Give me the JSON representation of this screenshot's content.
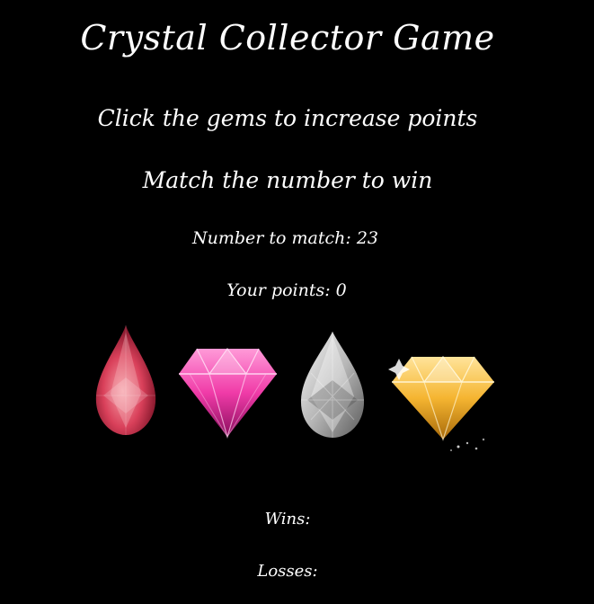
{
  "header": {
    "title": "Crystal Collector Game",
    "instruction_1": "Click the gems to increase points",
    "instruction_2": "Match the number to win"
  },
  "scoreboard": {
    "target_label": "Number to match: 23",
    "points_label": "Your points: 0",
    "wins_label": "Wins:",
    "losses_label": "Losses:"
  },
  "gems": [
    {
      "icon": "red-pear-gem-icon",
      "color": "#d9405a"
    },
    {
      "icon": "pink-round-gem-icon",
      "color": "#f03ba8"
    },
    {
      "icon": "white-pear-gem-icon",
      "color": "#d8d8d8"
    },
    {
      "icon": "yellow-round-gem-icon",
      "color": "#f5b531"
    }
  ],
  "colors": {
    "background": "#000000",
    "text": "#ffffff"
  }
}
